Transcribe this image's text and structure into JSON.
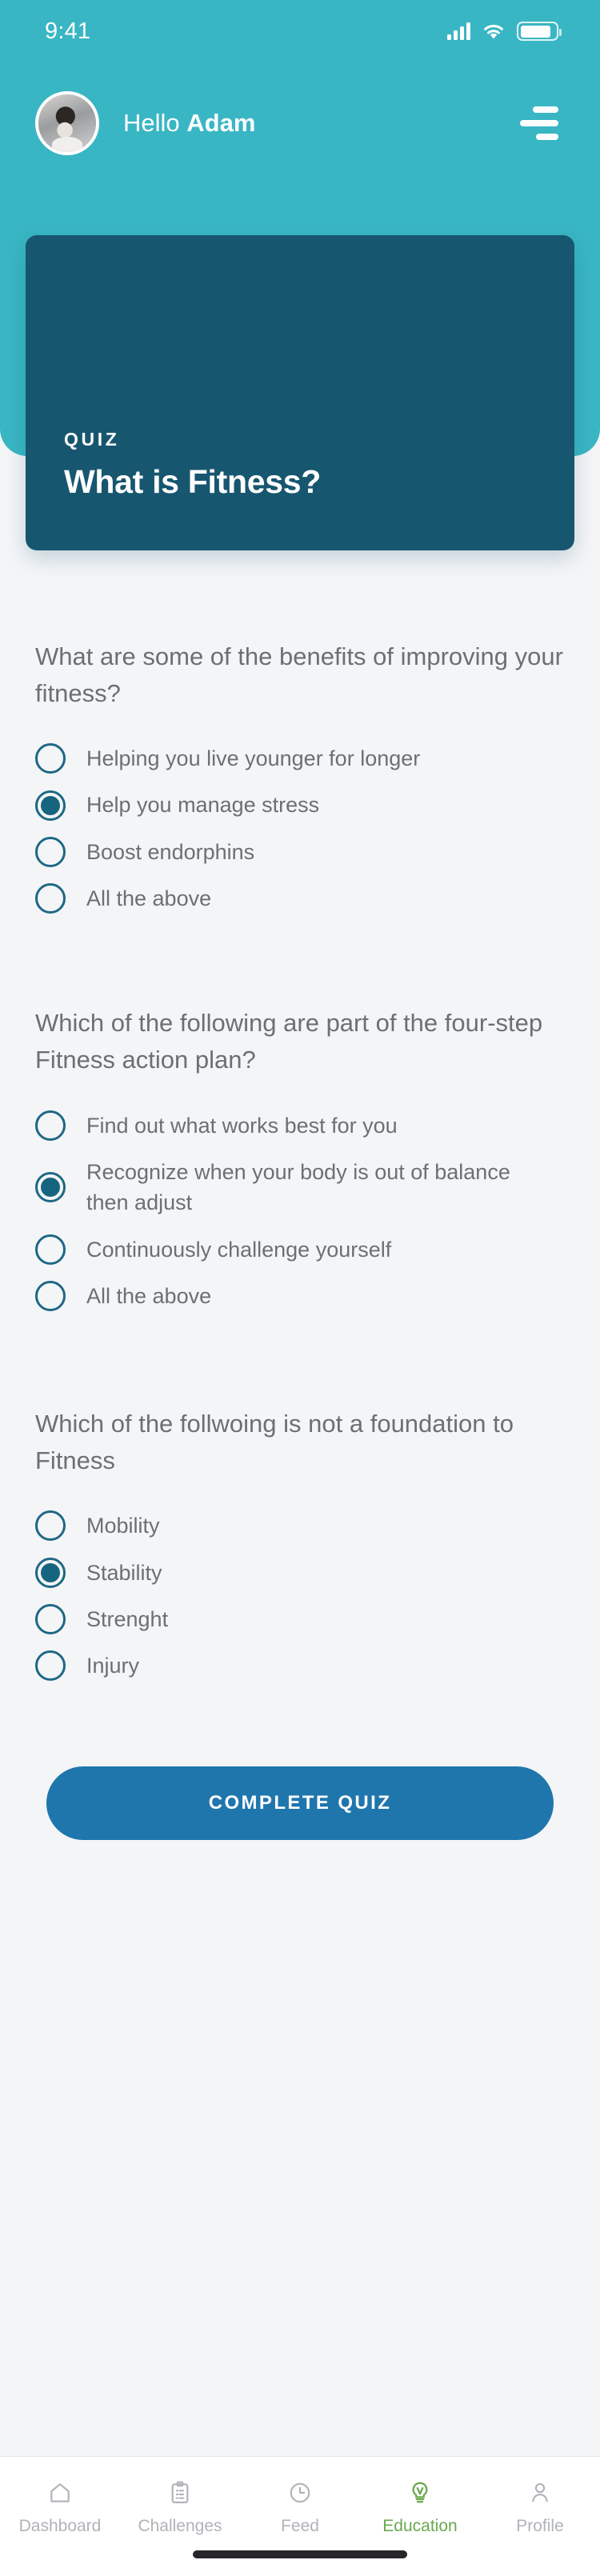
{
  "status_bar": {
    "time": "9:41",
    "icons": [
      "signal-icon",
      "wifi-icon",
      "battery-icon"
    ]
  },
  "header": {
    "greeting_prefix": "Hello ",
    "user_name": "Adam",
    "menu_icon": "hamburger-menu-icon",
    "avatar_icon": "user-avatar",
    "background_color": "#39b6c4"
  },
  "hero_card": {
    "kicker": "QUIZ",
    "title": "What is Fitness?",
    "background_color": "#17566f"
  },
  "quiz": {
    "questions": [
      {
        "text": "What are some of the benefits of improving your fitness?",
        "options": [
          {
            "label": "Helping you live younger for longer",
            "selected": false
          },
          {
            "label": "Help you manage stress",
            "selected": true
          },
          {
            "label": "Boost endorphins",
            "selected": false
          },
          {
            "label": "All the above",
            "selected": false
          }
        ]
      },
      {
        "text": "Which of the following are part of the four-step Fitness action plan?",
        "options": [
          {
            "label": "Find out what works best for you",
            "selected": false
          },
          {
            "label": "Recognize when your body is out of balance then adjust",
            "selected": true
          },
          {
            "label": "Continuously challenge yourself",
            "selected": false
          },
          {
            "label": "All the above",
            "selected": false
          }
        ]
      },
      {
        "text": "Which of the follwoing is not a foundation to Fitness",
        "options": [
          {
            "label": "Mobility",
            "selected": false
          },
          {
            "label": "Stability",
            "selected": true
          },
          {
            "label": "Strenght",
            "selected": false
          },
          {
            "label": "Injury",
            "selected": false
          }
        ]
      }
    ],
    "submit_label": "COMPLETE QUIZ",
    "submit_color": "#1f76ad",
    "radio_color": "#1d6884"
  },
  "bottom_nav": {
    "active_color": "#6aa84f",
    "inactive_color": "#b0b3b8",
    "items": [
      {
        "label": "Dashboard",
        "icon": "home-icon",
        "active": false
      },
      {
        "label": "Challenges",
        "icon": "clipboard-icon",
        "active": false
      },
      {
        "label": "Feed",
        "icon": "clock-icon",
        "active": false
      },
      {
        "label": "Education",
        "icon": "lightbulb-icon",
        "active": true
      },
      {
        "label": "Profile",
        "icon": "person-icon",
        "active": false
      }
    ]
  }
}
